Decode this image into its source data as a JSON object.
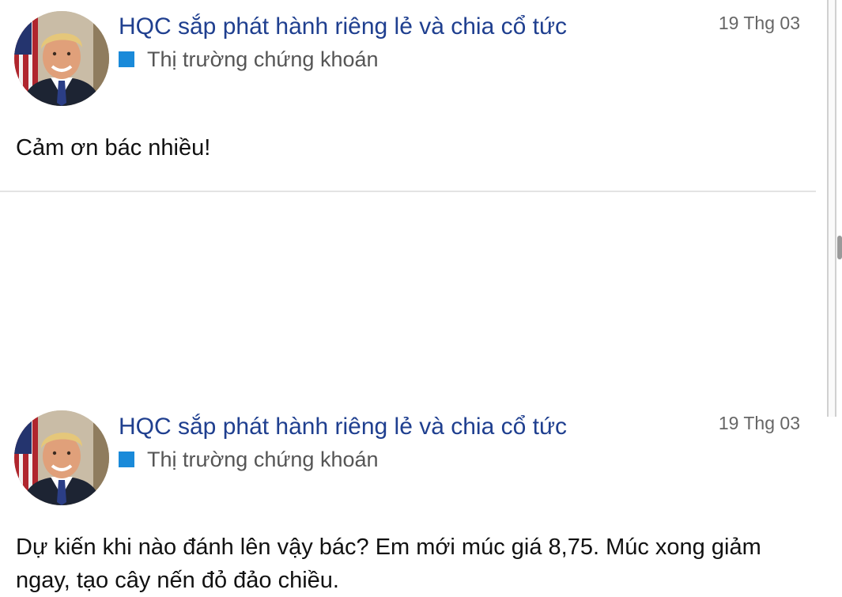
{
  "posts": [
    {
      "title": "HQC sắp phát hành riêng lẻ và chia cổ tức",
      "category": "Thị trường chứng khoán",
      "date": "19 Thg 03",
      "body": "Cảm ơn bác nhiều!",
      "avatar_icon": "user-avatar-photo"
    },
    {
      "title": "HQC sắp phát hành riêng lẻ và chia cổ tức",
      "category": "Thị trường chứng khoán",
      "date": "19 Thg 03",
      "body": "Dự kiến khi nào đánh lên vậy bác? Em mới múc giá 8,75. Múc xong giảm ngay, tạo cây nến đỏ đảo chiều.",
      "avatar_icon": "user-avatar-photo"
    }
  ],
  "colors": {
    "title": "#1f3f8f",
    "category_square": "#1a8ad9",
    "category_text": "#555555",
    "date_text": "#666666",
    "body_text": "#111111",
    "divider": "#e3e3e3"
  }
}
